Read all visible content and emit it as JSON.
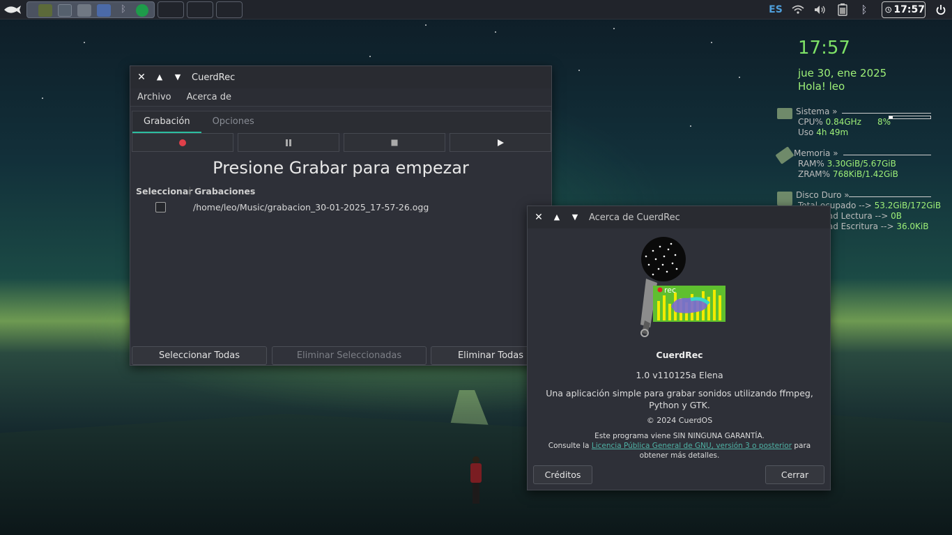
{
  "panel": {
    "language": "ES",
    "clock": "17:57"
  },
  "conky": {
    "time": "17:57",
    "date": "jue 30, ene 2025",
    "greeting": "Hola! leo",
    "system": {
      "title": "Sistema »",
      "cpu_label": "CPU%",
      "cpu_value": "0.84GHz",
      "cpu_percent_text": "8%",
      "cpu_fraction": 0.08,
      "uptime_label": "Uso",
      "uptime_value": "4h 49m"
    },
    "memory": {
      "title": "Memoria »",
      "ram_label": "RAM%",
      "ram_value": "3.30GiB/5.67GiB",
      "zram_label": "ZRAM%",
      "zram_value": "768KiB/1.42GiB"
    },
    "disk": {
      "title": "Disco Duro »",
      "total_label": "Total ocupado -->",
      "total_value": "53.2GiB/172GiB",
      "read_label": "Velocidad Lectura -->",
      "read_value": "0B",
      "write_label": "Velocidad Escritura -->",
      "write_value": "36.0KiB"
    }
  },
  "main_window": {
    "title": "CuerdRec",
    "menu": [
      "Archivo",
      "Acerca de"
    ],
    "tabs": [
      {
        "label": "Grabación",
        "active": true
      },
      {
        "label": "Opciones",
        "active": false
      }
    ],
    "headline": "Presione Grabar para empezar",
    "columns": [
      "Seleccionar",
      "Grabaciones"
    ],
    "recordings": [
      {
        "path": "/home/leo/Music/grabacion_30-01-2025_17-57-26.ogg",
        "selected": false
      }
    ],
    "buttons": {
      "select_all": "Seleccionar Todas",
      "delete_selected": "Eliminar Seleccionadas",
      "delete_all": "Eliminar Todas"
    },
    "colors": {
      "accent": "#2cbfa0",
      "record": "#e0404a"
    }
  },
  "about_dialog": {
    "title": "Acerca de CuerdRec",
    "logo_text": "rec",
    "app_name": "CuerdRec",
    "version": "1.0 v110125a Elena",
    "description": "Una aplicación simple para grabar sonidos utilizando ffmpeg, Python y GTK.",
    "copyright": "© 2024 CuerdOS",
    "license_line1": "Este programa viene SIN NINGUNA GARANTÍA.",
    "license_prefix": "Consulte la",
    "license_link": "Licencia Pública General de GNU, versión 3 o posterior",
    "license_suffix": "para obtener más detalles.",
    "credits_button": "Créditos",
    "close_button": "Cerrar"
  }
}
